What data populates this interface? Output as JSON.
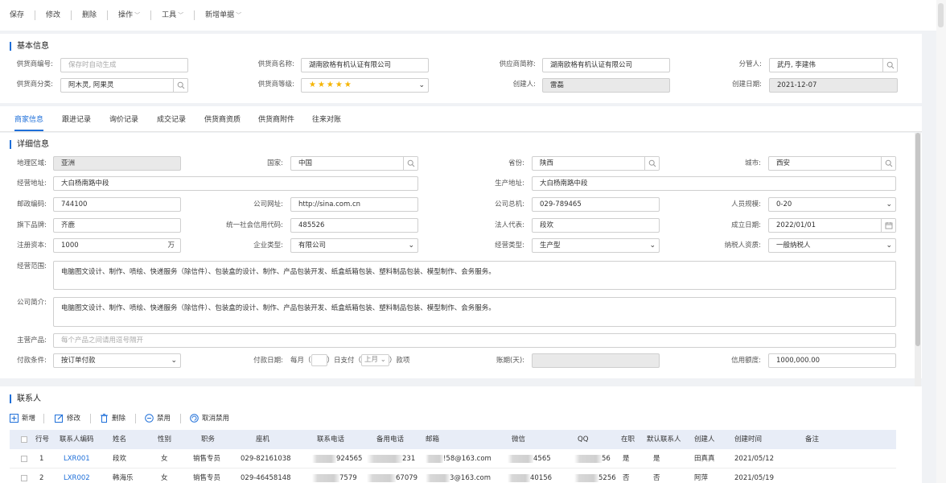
{
  "toolbar": {
    "save": "保存",
    "edit": "修改",
    "delete": "删除",
    "operate": "操作",
    "tools": "工具",
    "new_doc": "新增单据"
  },
  "basic": {
    "title": "基本信息",
    "supplier_code_label": "供货商编号:",
    "supplier_code_placeholder": "保存时自动生成",
    "supplier_name_label": "供货商名称:",
    "supplier_name_value": "湖南欧格有机认证有限公司",
    "supplier_short_label": "供应商简称:",
    "supplier_short_value": "湖南欧格有机认证有限公司",
    "manager_label": "分管人:",
    "manager_value": "武丹, 李建伟",
    "category_label": "供货商分类:",
    "category_value": "阿木灵, 阿果灵",
    "grade_label": "供货商等级:",
    "grade_stars": "★★★★★",
    "grade_value": 5,
    "creator_label": "创建人:",
    "creator_value": "雷磊",
    "created_label": "创建日期:",
    "created_value": "2021-12-07"
  },
  "tabs": [
    "商家信息",
    "跟进记录",
    "询价记录",
    "成交记录",
    "供货商资质",
    "供货商附件",
    "往来对账"
  ],
  "detail": {
    "title": "详细信息",
    "region_label": "地理区域:",
    "region_value": "亚洲",
    "country_label": "国家:",
    "country_value": "中国",
    "province_label": "省份:",
    "province_value": "陕西",
    "city_label": "城市:",
    "city_value": "西安",
    "biz_addr_label": "经营地址:",
    "biz_addr_value": "大白杨南路中段",
    "prod_addr_label": "生产地址:",
    "prod_addr_value": "大白杨南路中段",
    "postcode_label": "邮政编码:",
    "postcode_value": "744100",
    "website_label": "公司网址:",
    "website_value": "http://sina.com.cn",
    "phone_label": "公司总机:",
    "phone_value": "029-789465",
    "staff_label": "人员规模:",
    "staff_value": "0-20",
    "brand_label": "旗下品牌:",
    "brand_value": "齐鹿",
    "credit_code_label": "统一社会信用代码:",
    "credit_code_value": "485526",
    "legal_label": "法人代表:",
    "legal_value": "段欢",
    "founded_label": "成立日期:",
    "founded_value": "2022/01/01",
    "capital_label": "注册资本:",
    "capital_value": "1000",
    "capital_unit": "万",
    "ent_type_label": "企业类型:",
    "ent_type_value": "有限公司",
    "biz_type_label": "经营类型:",
    "biz_type_value": "生产型",
    "tax_label": "纳税人资质:",
    "tax_value": "一般纳税人",
    "scope_label": "经营范围:",
    "scope_value": "电脑图文设计、制作、喷绘、快递服务（除信件）、包装盒的设计、制作、产品包装开发、纸盒纸箱包装、塑料制品包装、模型制作、会务服务。",
    "intro_label": "公司简介:",
    "intro_value": "电脑图文设计、制作、喷绘、快递服务（除信件）、包装盒的设计、制作、产品包装开发、纸盒纸箱包装、塑料制品包装、模型制作、会务服务。",
    "main_product_label": "主营产品:",
    "main_product_placeholder": "每个产品之间请用逗号隔开",
    "pay_cond_label": "付款条件:",
    "pay_cond_value": "按订单付款",
    "pay_date_label": "付款日期:",
    "pay_date_prefix": "每月（",
    "pay_date_mid": "）日支付（",
    "pay_date_month": "上月",
    "pay_date_suffix": "）款项",
    "period_label": "账期(天):",
    "credit_label": "信用额度:",
    "credit_value": "1000,000.00"
  },
  "contacts": {
    "title": "联系人",
    "actions": [
      "新增",
      "修改",
      "删除",
      "禁用",
      "取消禁用"
    ],
    "columns": [
      "行号",
      "联系人编码",
      "姓名",
      "性别",
      "职务",
      "座机",
      "联系电话",
      "备用电话",
      "邮箱",
      "微信",
      "QQ",
      "在职",
      "默认联系人",
      "创建人",
      "创建时间",
      "备注"
    ],
    "rows": [
      [
        "1",
        "LXR001",
        "段欢",
        "女",
        "销售专员",
        "029-82161038",
        "924565",
        "231",
        "!58@163.com",
        "4565",
        "56",
        "是",
        "是",
        "田真真",
        "2021/05/12",
        ""
      ],
      [
        "2",
        "LXR002",
        "韩海乐",
        "女",
        "销售专员",
        "029-46458148",
        "7579",
        "67079",
        "3@163.com",
        "40156",
        "5256",
        "否",
        "否",
        "阿萍",
        "2021/05/19",
        ""
      ]
    ]
  },
  "colors": {
    "accent": "#1e6fd9",
    "star": "#f5b400"
  }
}
